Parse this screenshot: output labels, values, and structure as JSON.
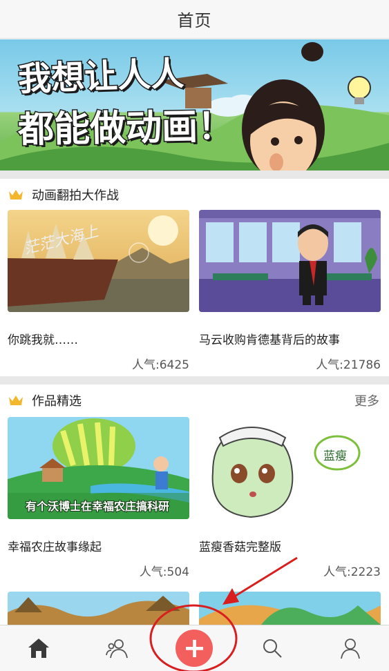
{
  "header": {
    "title": "首页"
  },
  "banner": {
    "line1": "我想让人人",
    "line2": "都能做动画！"
  },
  "sections": [
    {
      "title": "动画翻拍大作战",
      "more": "",
      "cards": [
        {
          "name": "你跳我就……",
          "popularity": "人气:6425",
          "overlay": "茫茫大海上"
        },
        {
          "name": "马云收购肯德基背后的故事",
          "popularity": "人气:21786",
          "overlay": ""
        }
      ]
    },
    {
      "title": "作品精选",
      "more": "更多",
      "cards": [
        {
          "name": "幸福农庄故事缘起",
          "popularity": "人气:504",
          "overlay": "有个沃博士在幸福农庄搞科研"
        },
        {
          "name": "蓝瘦香菇完整版",
          "popularity": "人气:2223",
          "overlay": "蓝瘦"
        }
      ]
    }
  ],
  "tabbar": {
    "items": [
      {
        "icon": "home-icon"
      },
      {
        "icon": "friends-icon"
      },
      {
        "icon": "plus-icon",
        "label": "+"
      },
      {
        "icon": "search-icon"
      },
      {
        "icon": "profile-icon"
      }
    ]
  },
  "colors": {
    "accent": "#f25f5c",
    "crown": "#f2b72c",
    "annotation": "#d81e1e",
    "divider": "#e8e8e8"
  }
}
